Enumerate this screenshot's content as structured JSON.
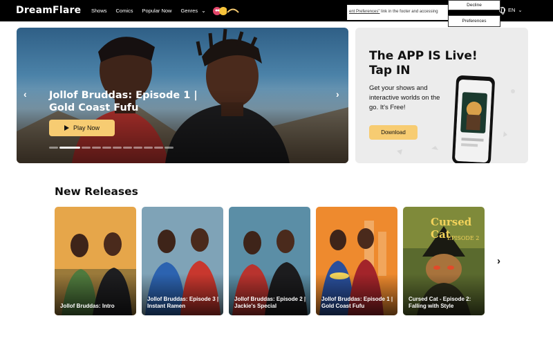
{
  "header": {
    "logo": "DreamFlare",
    "nav": [
      {
        "label": "Shows"
      },
      {
        "label": "Comics"
      },
      {
        "label": "Popular Now"
      },
      {
        "label": "Genres"
      }
    ],
    "language": "EN"
  },
  "cookie_banner": {
    "text_link": "ent Preferences\"",
    "text_rest": " link in the footer and accessing",
    "decline_label": "Decline",
    "preferences_label": "Preferences"
  },
  "hero": {
    "title": "Jollof Bruddas: Episode 1 | Gold Coast Fufu",
    "play_label": "Play Now",
    "slide_count": 11,
    "active_slide": 1
  },
  "promo": {
    "title": "The APP IS Live! Tap IN",
    "text": "Get your shows and interactive worlds on the go. It's Free!",
    "download_label": "Download"
  },
  "new_releases": {
    "title": "New Releases",
    "items": [
      {
        "label": "Jollof Bruddas: Intro"
      },
      {
        "label": "Jollof Bruddas: Episode 3 | Instant Ramen"
      },
      {
        "label": "Jollof Bruddas: Episode 2 | Jackie's Special"
      },
      {
        "label": "Jollof Bruddas: Episode 1 | Gold Coast Fufu"
      },
      {
        "label": "Cursed Cat - Episode 2: Falling with Style",
        "art_title": "Cursed Cat",
        "art_subtitle": "EPISODE 2"
      }
    ]
  },
  "colors": {
    "accent": "#f7cc72",
    "header_bg": "#000000",
    "promo_bg": "#ececec"
  }
}
